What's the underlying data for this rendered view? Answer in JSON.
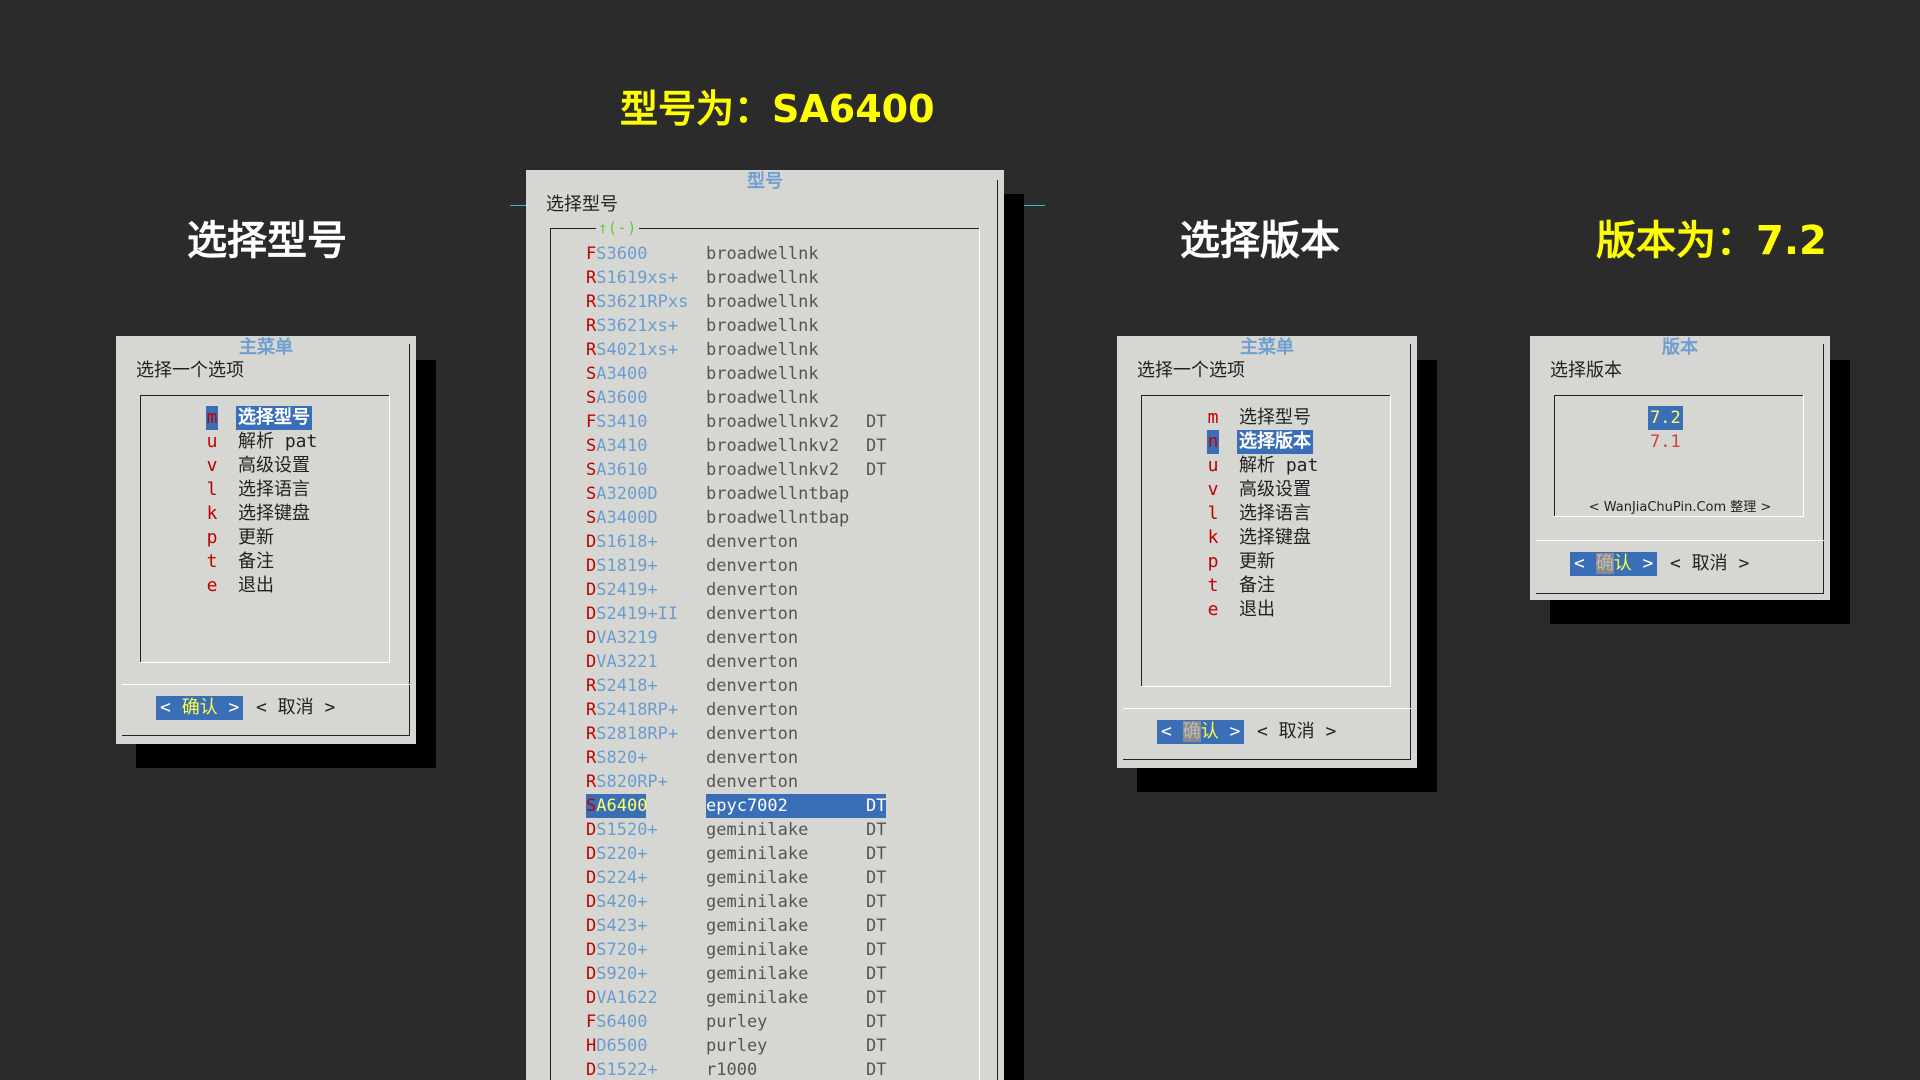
{
  "captions": {
    "select_model": "选择型号",
    "model_is": "型号为：SA6400",
    "select_version": "选择版本",
    "version_is": "版本为：7.2"
  },
  "main_menu_1": {
    "title": "主菜单",
    "prompt": "选择一个选项",
    "items": [
      {
        "key": "m",
        "label": "选择型号"
      },
      {
        "key": "u",
        "label": "解析 pat"
      },
      {
        "key": "v",
        "label": "高级设置"
      },
      {
        "key": "l",
        "label": "选择语言"
      },
      {
        "key": "k",
        "label": "选择键盘"
      },
      {
        "key": "p",
        "label": "更新"
      },
      {
        "key": "t",
        "label": "备注"
      },
      {
        "key": "e",
        "label": "退出"
      }
    ],
    "ok": {
      "left": "<",
      "hot": "确",
      "rest": "认",
      "right": ">"
    },
    "cancel": "<  取消  >"
  },
  "model_dialog": {
    "title": "型号",
    "prompt": "选择型号",
    "scroll": "↑(-)",
    "rows": [
      {
        "f": "F",
        "rest": "S3600",
        "platform": "broadwellnk",
        "tag": ""
      },
      {
        "f": "R",
        "rest": "S1619xs+",
        "platform": "broadwellnk",
        "tag": ""
      },
      {
        "f": "R",
        "rest": "S3621RPxs",
        "platform": "broadwellnk",
        "tag": ""
      },
      {
        "f": "R",
        "rest": "S3621xs+",
        "platform": "broadwellnk",
        "tag": ""
      },
      {
        "f": "R",
        "rest": "S4021xs+",
        "platform": "broadwellnk",
        "tag": ""
      },
      {
        "f": "S",
        "rest": "A3400",
        "platform": "broadwellnk",
        "tag": ""
      },
      {
        "f": "S",
        "rest": "A3600",
        "platform": "broadwellnk",
        "tag": ""
      },
      {
        "f": "F",
        "rest": "S3410",
        "platform": "broadwellnkv2",
        "tag": "DT"
      },
      {
        "f": "S",
        "rest": "A3410",
        "platform": "broadwellnkv2",
        "tag": "DT"
      },
      {
        "f": "S",
        "rest": "A3610",
        "platform": "broadwellnkv2",
        "tag": "DT"
      },
      {
        "f": "S",
        "rest": "A3200D",
        "platform": "broadwellntbap",
        "tag": ""
      },
      {
        "f": "S",
        "rest": "A3400D",
        "platform": "broadwellntbap",
        "tag": ""
      },
      {
        "f": "D",
        "rest": "S1618+",
        "platform": "denverton",
        "tag": ""
      },
      {
        "f": "D",
        "rest": "S1819+",
        "platform": "denverton",
        "tag": ""
      },
      {
        "f": "D",
        "rest": "S2419+",
        "platform": "denverton",
        "tag": ""
      },
      {
        "f": "D",
        "rest": "S2419+II",
        "platform": "denverton",
        "tag": ""
      },
      {
        "f": "D",
        "rest": "VA3219",
        "platform": "denverton",
        "tag": ""
      },
      {
        "f": "D",
        "rest": "VA3221",
        "platform": "denverton",
        "tag": ""
      },
      {
        "f": "R",
        "rest": "S2418+",
        "platform": "denverton",
        "tag": ""
      },
      {
        "f": "R",
        "rest": "S2418RP+",
        "platform": "denverton",
        "tag": ""
      },
      {
        "f": "R",
        "rest": "S2818RP+",
        "platform": "denverton",
        "tag": ""
      },
      {
        "f": "R",
        "rest": "S820+",
        "platform": "denverton",
        "tag": ""
      },
      {
        "f": "R",
        "rest": "S820RP+",
        "platform": "denverton",
        "tag": ""
      },
      {
        "f": "S",
        "rest": "A6400",
        "platform": "epyc7002",
        "tag": "DT",
        "selected": true
      },
      {
        "f": "D",
        "rest": "S1520+",
        "platform": "geminilake",
        "tag": "DT"
      },
      {
        "f": "D",
        "rest": "S220+",
        "platform": "geminilake",
        "tag": "DT"
      },
      {
        "f": "D",
        "rest": "S224+",
        "platform": "geminilake",
        "tag": "DT"
      },
      {
        "f": "D",
        "rest": "S420+",
        "platform": "geminilake",
        "tag": "DT"
      },
      {
        "f": "D",
        "rest": "S423+",
        "platform": "geminilake",
        "tag": "DT"
      },
      {
        "f": "D",
        "rest": "S720+",
        "platform": "geminilake",
        "tag": "DT"
      },
      {
        "f": "D",
        "rest": "S920+",
        "platform": "geminilake",
        "tag": "DT"
      },
      {
        "f": "D",
        "rest": "VA1622",
        "platform": "geminilake",
        "tag": "DT"
      },
      {
        "f": "F",
        "rest": "S6400",
        "platform": "purley",
        "tag": "DT"
      },
      {
        "f": "H",
        "rest": "D6500",
        "platform": "purley",
        "tag": "DT"
      },
      {
        "f": "D",
        "rest": "S1522+",
        "platform": "r1000",
        "tag": "DT"
      }
    ]
  },
  "main_menu_2": {
    "title": "主菜单",
    "prompt": "选择一个选项",
    "items": [
      {
        "key": "m",
        "label": "选择型号"
      },
      {
        "key": "n",
        "label": "选择版本"
      },
      {
        "key": "u",
        "label": "解析 pat"
      },
      {
        "key": "v",
        "label": "高级设置"
      },
      {
        "key": "l",
        "label": "选择语言"
      },
      {
        "key": "k",
        "label": "选择键盘"
      },
      {
        "key": "p",
        "label": "更新"
      },
      {
        "key": "t",
        "label": "备注"
      },
      {
        "key": "e",
        "label": "退出"
      }
    ],
    "ok": {
      "left": "<",
      "hot": "确",
      "rest": "认",
      "right": ">"
    },
    "cancel": "<  取消  >"
  },
  "version_dialog": {
    "title": "版本",
    "prompt": "选择版本",
    "items": [
      "7.2",
      "7.1"
    ],
    "watermark": "< WanJiaChuPin.Com 整理 >",
    "ok": {
      "left": "<",
      "hot": "确",
      "rest": "认",
      "right": ">"
    },
    "cancel": "<  取消  >"
  }
}
